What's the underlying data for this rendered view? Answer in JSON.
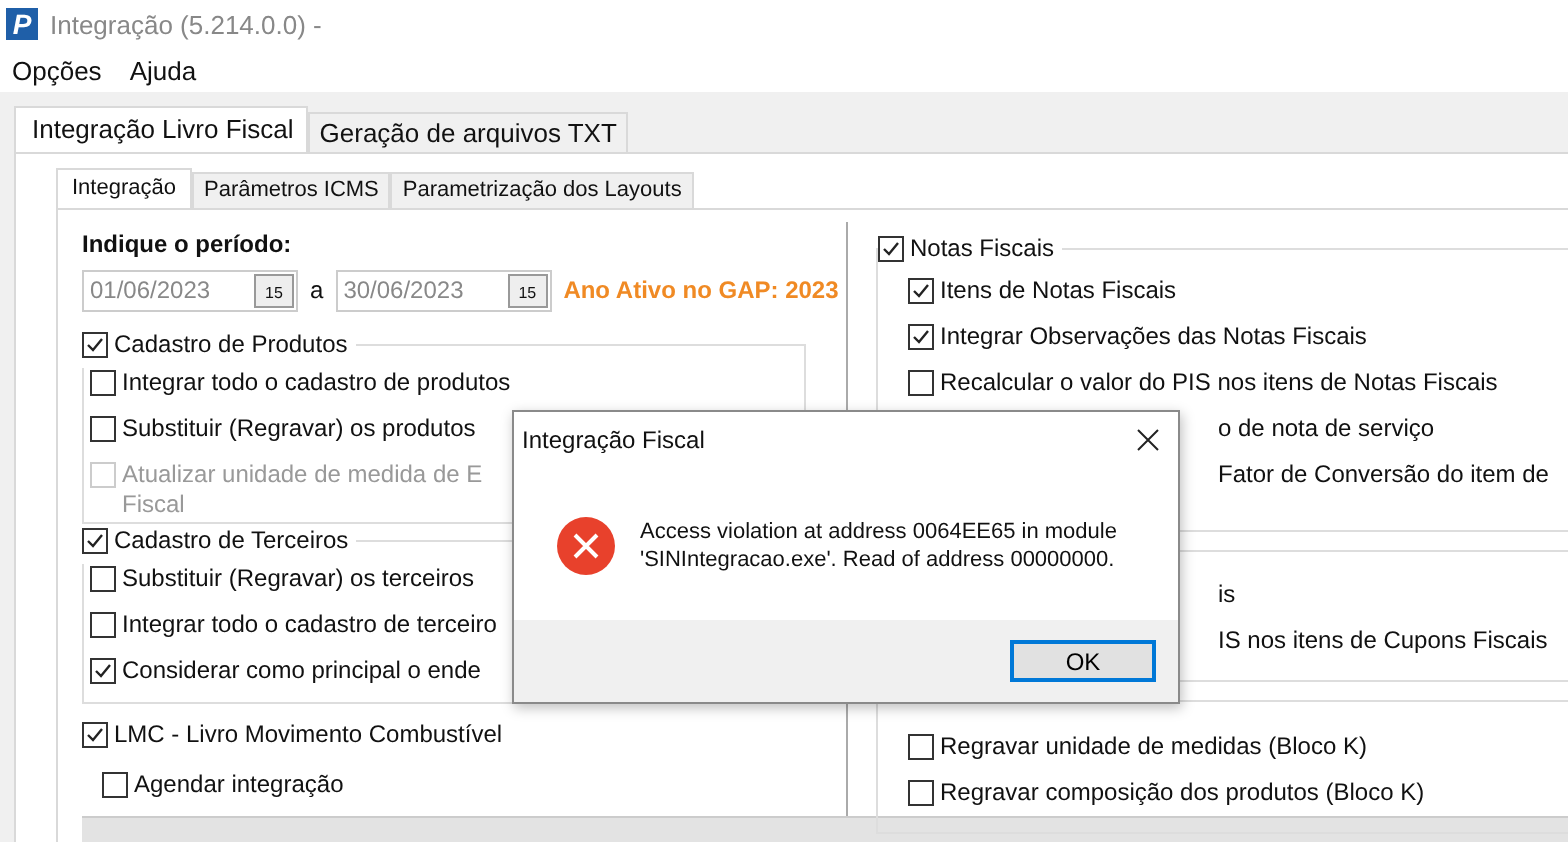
{
  "window": {
    "app_icon_letter": "P",
    "title": "Integração (5.214.0.0) -"
  },
  "menu": [
    "Opções",
    "Ajuda"
  ],
  "tabs": [
    {
      "label": "Integração Livro Fiscal",
      "selected": true
    },
    {
      "label": "Geração de arquivos TXT",
      "selected": false
    }
  ],
  "subtabs": [
    {
      "label": "Integração",
      "selected": true
    },
    {
      "label": "Parâmetros ICMS",
      "selected": false
    },
    {
      "label": "Parametrização dos Layouts",
      "selected": false
    }
  ],
  "period": {
    "label": "Indique o período:",
    "from": "01/06/2023",
    "from_calendar": "15",
    "connector": "a",
    "to": "30/06/2023",
    "to_calendar": "15",
    "active_year": "Ano Ativo no GAP: 2023"
  },
  "left_groups": [
    {
      "label": "Cadastro de Produtos",
      "checked": true,
      "options": [
        {
          "kind": "checkbox",
          "label": "Integrar todo o cadastro de produtos",
          "checked": false,
          "disabled": false
        },
        {
          "kind": "checkbox",
          "label": "Substituir (Regravar) os produtos",
          "checked": false,
          "disabled": false
        },
        {
          "kind": "checkbox",
          "label": "Atualizar unidade de medida de E",
          "label_line2": "Fiscal",
          "checked": false,
          "disabled": true
        }
      ]
    },
    {
      "label": "Cadastro de Terceiros",
      "checked": true,
      "options": [
        {
          "kind": "checkbox",
          "label": "Substituir (Regravar) os terceiros",
          "checked": false,
          "disabled": false
        },
        {
          "kind": "checkbox",
          "label": "Integrar todo o cadastro de terceiro",
          "checked": false,
          "disabled": false
        },
        {
          "kind": "checkbox",
          "label": "Considerar como principal o ende",
          "checked": true,
          "disabled": false
        }
      ]
    }
  ],
  "lmc": {
    "label": "LMC - Livro Movimento Combustível",
    "checked": true
  },
  "schedule": {
    "label": "Agendar integração",
    "checked": false
  },
  "right_groups": [
    {
      "label": "Notas Fiscais",
      "checked": true,
      "options": [
        {
          "kind": "checkbox",
          "label": "Itens de Notas Fiscais",
          "checked": true
        },
        {
          "kind": "checkbox",
          "label": "Integrar Observações das Notas Fiscais",
          "checked": true
        },
        {
          "kind": "checkbox",
          "label": "Recalcular o valor do PIS nos itens de Notas Fiscais",
          "checked": false
        },
        {
          "kind": "partial",
          "label": "o de nota de serviço"
        },
        {
          "kind": "partial",
          "label": "Fator de Conversão do item de"
        }
      ]
    },
    {
      "options": [
        {
          "kind": "partial",
          "label": "is"
        },
        {
          "kind": "partial",
          "label": "IS nos itens de Cupons Fiscais"
        }
      ]
    },
    {
      "options": [
        {
          "kind": "checkbox",
          "label": "Regravar unidade de medidas (Bloco K)",
          "checked": false
        },
        {
          "kind": "checkbox",
          "label": "Regravar composição dos produtos (Bloco K)",
          "checked": false
        }
      ]
    }
  ],
  "dialog": {
    "title": "Integração Fiscal",
    "message": "Access violation at address 0064EE65 in module\n'SINIntegracao.exe'. Read of address 00000000.",
    "button": "OK"
  }
}
